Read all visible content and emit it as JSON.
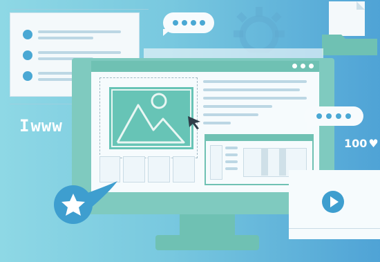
{
  "www_label": "www",
  "likes_count": "100",
  "icons": [
    "image-placeholder-icon",
    "mountain-icon",
    "cursor-icon",
    "star-icon",
    "play-icon",
    "heart-icon",
    "folder-icon",
    "gear-icon",
    "speech-bubble-icon"
  ],
  "colors": {
    "background_left": "#8ed8e5",
    "background_right": "#4fa3d6",
    "teal_accent": "#67c4b6",
    "panel_white": "#f6fbfd",
    "blue_dot": "#4aa8d4"
  }
}
